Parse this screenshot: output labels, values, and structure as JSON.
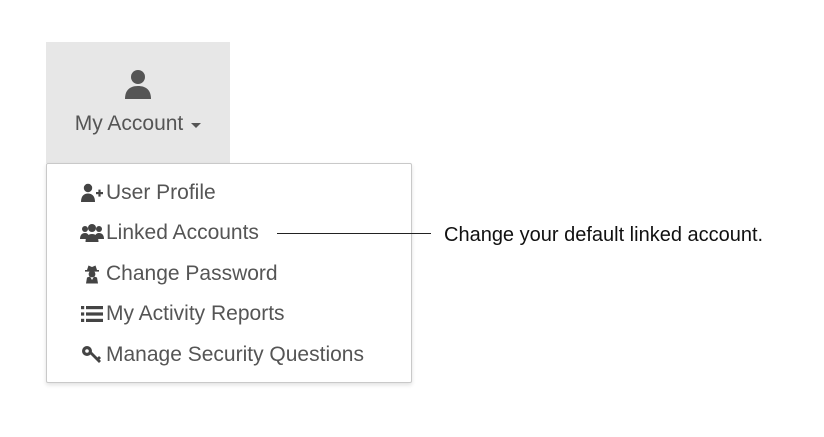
{
  "account_menu": {
    "button_label": "My Account",
    "button_icon": "user-icon",
    "caret_icon": "caret-down-icon",
    "items": [
      {
        "label": "User Profile",
        "icon": "user-plus-icon"
      },
      {
        "label": "Linked Accounts",
        "icon": "users-icon"
      },
      {
        "label": "Change Password",
        "icon": "user-secret-icon"
      },
      {
        "label": "My Activity Reports",
        "icon": "list-icon"
      },
      {
        "label": "Manage Security Questions",
        "icon": "key-icon"
      }
    ]
  },
  "callout": {
    "text": "Change your default linked account."
  },
  "colors": {
    "button_background": "#e7e7e7",
    "text": "#555555",
    "callout_text": "#111111",
    "dropdown_border": "#c9c9c9"
  }
}
